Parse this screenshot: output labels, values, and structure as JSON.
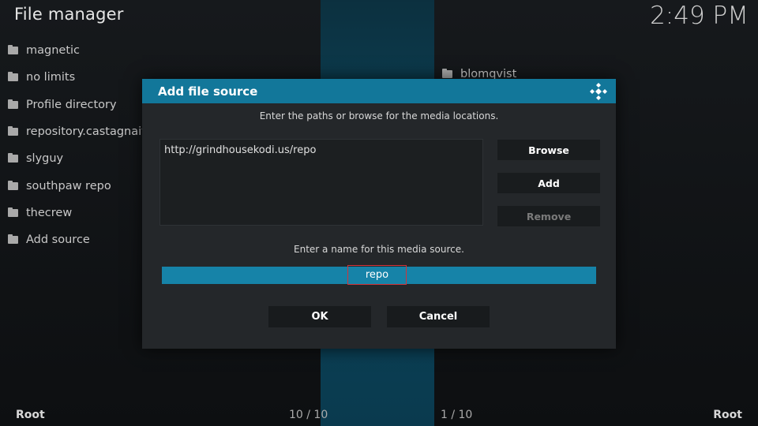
{
  "header": {
    "title": "File manager",
    "clock": "2:49 PM"
  },
  "left_list": [
    {
      "label": "magnetic"
    },
    {
      "label": "no limits"
    },
    {
      "label": "Profile directory"
    },
    {
      "label": "repository.castagnait"
    },
    {
      "label": "slyguy"
    },
    {
      "label": "southpaw repo"
    },
    {
      "label": "thecrew"
    },
    {
      "label": "Add source"
    }
  ],
  "right_list": [
    {
      "label": "blomqvist"
    }
  ],
  "footer": {
    "left_label": "Root",
    "left_count": "10 / 10",
    "right_count": "1 / 10",
    "right_label": "Root"
  },
  "dialog": {
    "title": "Add file source",
    "instruction_paths": "Enter the paths or browse for the media locations.",
    "path_entry": "http://grindhousekodi.us/repo",
    "browse_label": "Browse",
    "add_label": "Add",
    "remove_label": "Remove",
    "instruction_name": "Enter a name for this media source.",
    "name_value": "repo",
    "ok_label": "OK",
    "cancel_label": "Cancel"
  },
  "colors": {
    "accent": "#12779a",
    "name_field": "#1683a8",
    "highlight_border": "#d1343a"
  }
}
